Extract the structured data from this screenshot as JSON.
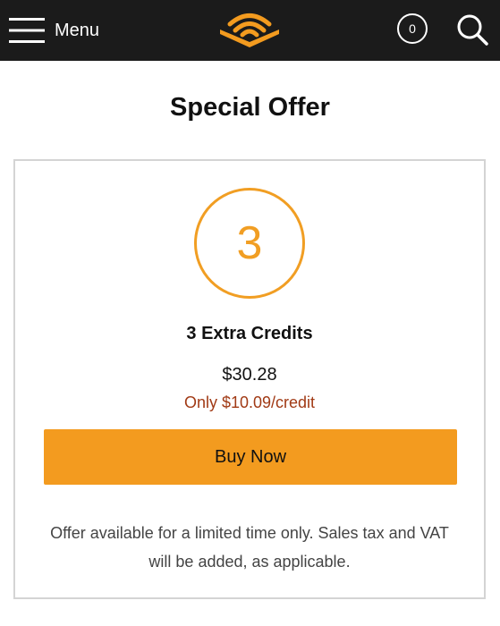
{
  "header": {
    "menu_label": "Menu",
    "cart_count": "0",
    "icons": {
      "menu": "hamburger-menu-icon",
      "logo": "audible-logo",
      "cart": "cart-count-badge",
      "search": "search-icon"
    },
    "colors": {
      "background": "#1b1b1b",
      "logo": "#f39b1f"
    }
  },
  "page": {
    "title": "Special Offer"
  },
  "offer": {
    "credit_number": "3",
    "name": "3 Extra Credits",
    "price": "$30.28",
    "per_credit": "Only $10.09/credit",
    "buy_label": "Buy Now",
    "disclaimer": "Offer available for a limited time only. Sales tax and VAT will be added, as applicable.",
    "colors": {
      "accent": "#f19e23",
      "button": "#f39b1f",
      "per_credit_text": "#a13a15"
    }
  }
}
